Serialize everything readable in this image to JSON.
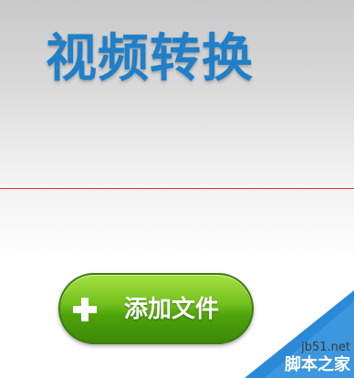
{
  "header": {
    "title": "视频转换"
  },
  "actions": {
    "add_file_label": "添加文件"
  },
  "watermark": {
    "url": "jb51.net",
    "site_name": "脚本之家"
  },
  "colors": {
    "title": "#1f7fc8",
    "divider": "#e02a2a",
    "button_green": "#4ea30c",
    "watermark_blue": "#2a8ad8"
  },
  "icons": {
    "add_button_icon": "plus-icon"
  }
}
